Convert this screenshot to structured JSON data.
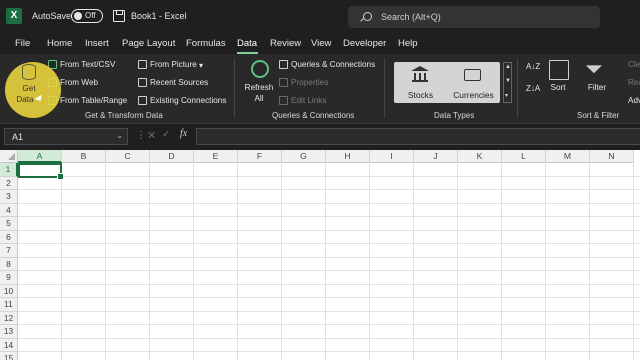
{
  "titlebar": {
    "autosave_label": "AutoSave",
    "autosave_state": "Off",
    "document_title": "Book1  -  Excel",
    "search_placeholder": "Search (Alt+Q)"
  },
  "menu": {
    "tabs": [
      "File",
      "Home",
      "Insert",
      "Page Layout",
      "Formulas",
      "Data",
      "Review",
      "View",
      "Developer",
      "Help"
    ],
    "active_tab": "Data"
  },
  "ribbon": {
    "get_transform": {
      "get_data_line1": "Get",
      "get_data_line2": "Data",
      "from_text_csv": "From Text/CSV",
      "from_web": "From Web",
      "from_table_range": "From Table/Range",
      "from_picture": "From Picture",
      "recent_sources": "Recent Sources",
      "existing_connections": "Existing Connections",
      "group_label": "Get & Transform Data"
    },
    "queries": {
      "refresh_all_line1": "Refresh",
      "refresh_all_line2": "All",
      "queries_connections": "Queries & Connections",
      "properties": "Properties",
      "edit_links": "Edit Links",
      "group_label": "Queries & Connections"
    },
    "data_types": {
      "stocks": "Stocks",
      "currencies": "Currencies",
      "group_label": "Data Types"
    },
    "sort_filter": {
      "sort": "Sort",
      "filter": "Filter",
      "clear_partial": "Cle",
      "reapply_partial": "Rea",
      "advanced_partial": "Adv",
      "group_label": "Sort & Filter"
    }
  },
  "formula_bar": {
    "name_box": "A1",
    "fx": "fx",
    "formula": ""
  },
  "sheet": {
    "columns": [
      "A",
      "B",
      "C",
      "D",
      "E",
      "F",
      "G",
      "H",
      "I",
      "J",
      "K",
      "L",
      "M",
      "N"
    ],
    "rows": [
      "1",
      "2",
      "3",
      "4",
      "5",
      "6",
      "7",
      "8",
      "9",
      "10",
      "11",
      "12",
      "13",
      "14",
      "15"
    ],
    "active_cell": "A1"
  },
  "colors": {
    "excel_green": "#1d6f42",
    "highlight": "#eed73c",
    "ribbon_bg": "#292929"
  }
}
